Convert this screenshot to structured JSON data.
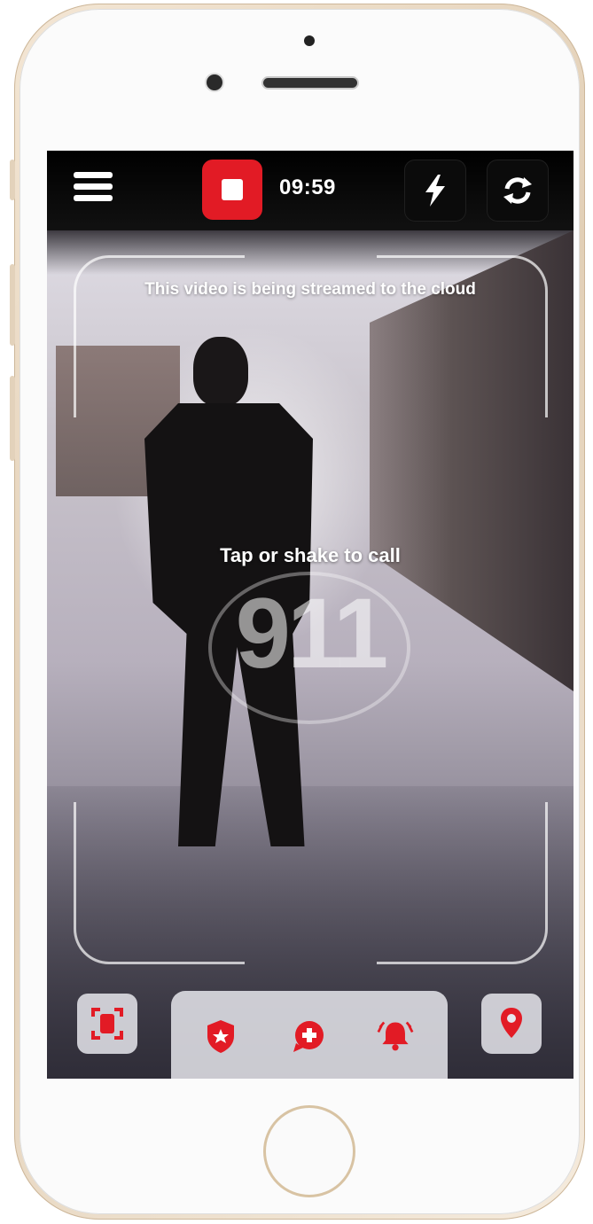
{
  "status_bar": {
    "timer": "09:59"
  },
  "overlay": {
    "stream_notice": "This video is being streamed to the cloud",
    "call_prompt": "Tap or shake to call",
    "emergency_number": "911"
  },
  "colors": {
    "accent_red": "#e21b25",
    "bar_background": "#000000",
    "tray_background": "#e6e6ec"
  },
  "icons": {
    "menu": "hamburger-menu-icon",
    "record": "stop-record-icon",
    "flash": "lightning-bolt-icon",
    "switch_camera": "camera-switch-icon",
    "focus": "focus-frame-icon",
    "police": "police-badge-icon",
    "medical": "medical-chat-icon",
    "alarm": "alarm-bell-icon",
    "location": "location-pin-icon"
  }
}
